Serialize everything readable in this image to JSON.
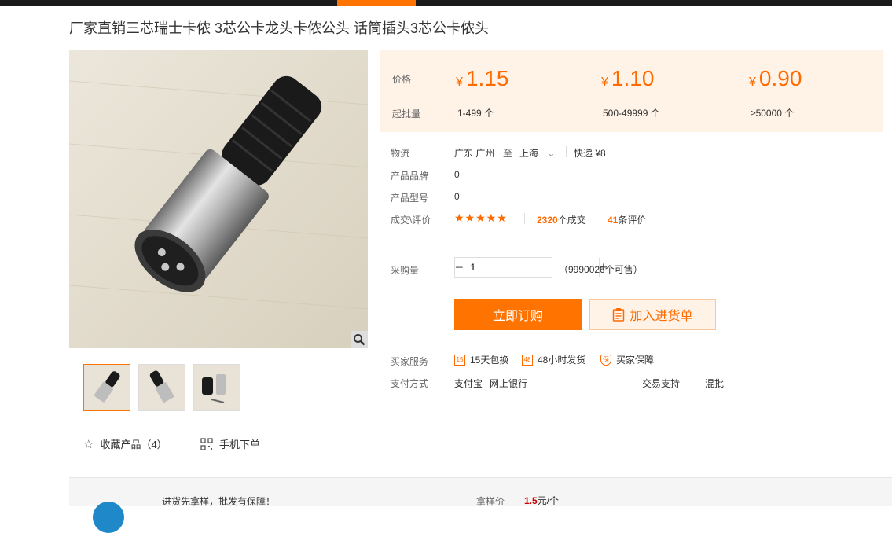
{
  "page": {
    "title": "厂家直销三芯瑞士卡侬 3芯公卡龙头卡侬公头 话筒插头3芯公卡侬头"
  },
  "icons": {
    "zoom": "magnifier-icon",
    "favorite": "star-outline-icon",
    "mobile_order": "qr-code-icon",
    "cart": "clipboard-icon"
  },
  "colors": {
    "accent": "#ff7300",
    "price": "#ff6a00",
    "price_bg": "#fff3e8"
  },
  "pricing": {
    "price_label": "价格",
    "moq_label": "起批量",
    "currency": "¥",
    "tiers": [
      {
        "price": "1.15",
        "moq": "1-499 个"
      },
      {
        "price": "1.10",
        "moq": "500-49999 个"
      },
      {
        "price": "0.90",
        "moq": "≥50000 个"
      }
    ]
  },
  "details": {
    "logistics_label": "物流",
    "from": "广东 广州",
    "to_word": "至",
    "to": "上海",
    "shipping": "快递 ¥8",
    "brand_label": "产品品牌",
    "brand": "0",
    "model_label": "产品型号",
    "model": "0",
    "deals_label": "成交\\评价",
    "stars": "★★★★★",
    "deals_count": "2320",
    "deals_suffix": "个成交",
    "reviews_count": "41",
    "reviews_suffix": "条评价"
  },
  "purchase": {
    "qty_label": "采购量",
    "qty_value": "1",
    "stock": "（9990026个可售）",
    "order_button": "立即订购",
    "cart_button": "加入进货单"
  },
  "services": {
    "label": "买家服务",
    "items": [
      {
        "badge": "15",
        "text": "15天包换"
      },
      {
        "badge": "48",
        "text": "48小时发货"
      },
      {
        "badge": "保",
        "text": "买家保障"
      }
    ],
    "payment_label": "支付方式",
    "payment_methods": [
      "支付宝",
      "网上银行"
    ],
    "trade_support_label": "交易支持",
    "trade_support": "混批"
  },
  "gallery": {
    "favorite_label": "收藏产品（4）",
    "mobile_label": "手机下单"
  },
  "footer": {
    "promo": "进货先拿样，批发有保障！",
    "sample_label": "拿样价",
    "sample_price": "1.5",
    "sample_unit": "元/个"
  }
}
